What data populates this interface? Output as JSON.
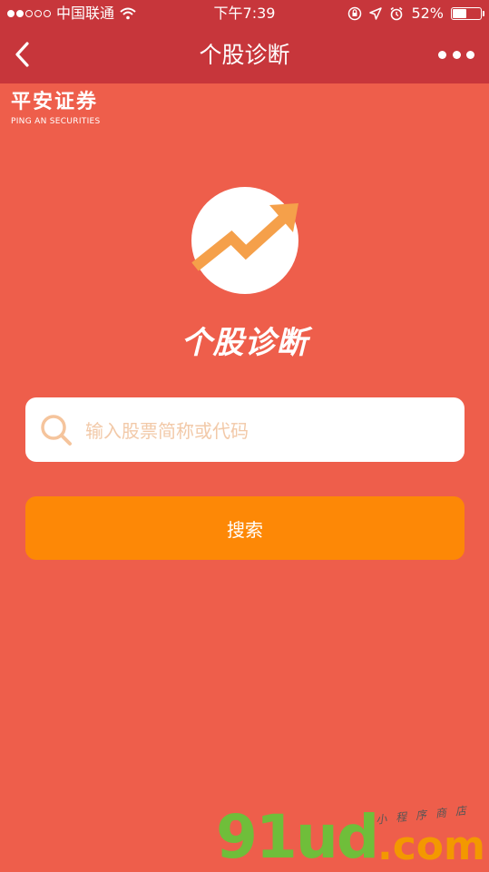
{
  "status_bar": {
    "carrier": "中国联通",
    "time": "下午7:39",
    "battery_percent": "52%",
    "battery_level": 0.52,
    "signal_bars": 2,
    "icons": [
      "signal-dots-icon",
      "wifi-icon",
      "rotation-lock-icon",
      "location-arrow-icon",
      "alarm-icon",
      "battery-icon"
    ]
  },
  "nav": {
    "title": "个股诊断",
    "back_icon": "chevron-left-icon",
    "more_icon": "more-dots-icon"
  },
  "brand": {
    "name_cn": "平安证券",
    "name_en": "PING AN SECURITIES"
  },
  "logo": {
    "icon": "trend-up-arrow-icon",
    "title": "个股诊断"
  },
  "search": {
    "placeholder": "输入股票简称或代码",
    "value": "",
    "icon": "search-icon"
  },
  "search_button": {
    "label": "搜索"
  },
  "watermark": {
    "logo": "91ud",
    "suffix": ".com",
    "tagline": "小程序商店"
  },
  "colors": {
    "page_bg": "#ee5e4b",
    "header_bg": "#c7363b",
    "button_bg": "#fd8806",
    "logo_accent": "#f5a04a",
    "placeholder": "#f2c9a8"
  }
}
